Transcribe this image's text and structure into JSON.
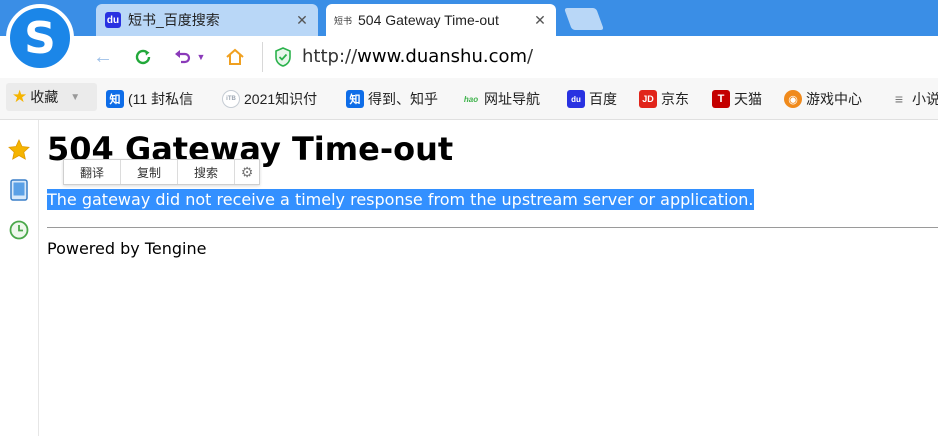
{
  "tabs": [
    {
      "title": "短书_百度搜索",
      "favicon": "baidu-paw-icon",
      "active": false
    },
    {
      "title": "504 Gateway Time-out",
      "favicon_text": "短书",
      "active": true
    }
  ],
  "nav": {
    "url_scheme": "http://",
    "url_host": "www.duanshu.com",
    "url_path": "/"
  },
  "bookmarks": {
    "favorites_label": "收藏",
    "items": [
      {
        "label": "(11 封私信",
        "icon_text": "知",
        "icon_color": "#0e6de8"
      },
      {
        "label": "2021知识付",
        "icon_text": "iTB",
        "icon_color": "#9aa4b0"
      },
      {
        "label": "得到、知乎",
        "icon_text": "知",
        "icon_color": "#0e6de8"
      },
      {
        "label": "网址导航",
        "icon_text": "hao",
        "icon_color": "#3db24a"
      },
      {
        "label": "百度",
        "icon_text": "du",
        "icon_color": "#2932e1"
      },
      {
        "label": "京东",
        "icon_text": "JD",
        "icon_color": "#e1251b"
      },
      {
        "label": "天猫",
        "icon_text": "T",
        "icon_color": "#c40000"
      },
      {
        "label": "游戏中心",
        "icon_text": "◉",
        "icon_color": "#f08a1c"
      },
      {
        "label": "小说",
        "icon_text": "≡",
        "icon_color": "#777777"
      }
    ]
  },
  "page": {
    "heading": "504 Gateway Time-out",
    "message": "The gateway did not receive a timely response from the upstream server or application.",
    "footer": "Powered by Tengine"
  },
  "selection_popup": {
    "translate": "翻译",
    "copy": "复制",
    "search": "搜索"
  },
  "colors": {
    "tabstrip": "#3a8ee6",
    "selection": "#3390ff",
    "accent_green": "#2bb24c",
    "refresh_green": "#22a83a",
    "undo_purple": "#8a3ab9",
    "home_orange": "#f0a020"
  }
}
